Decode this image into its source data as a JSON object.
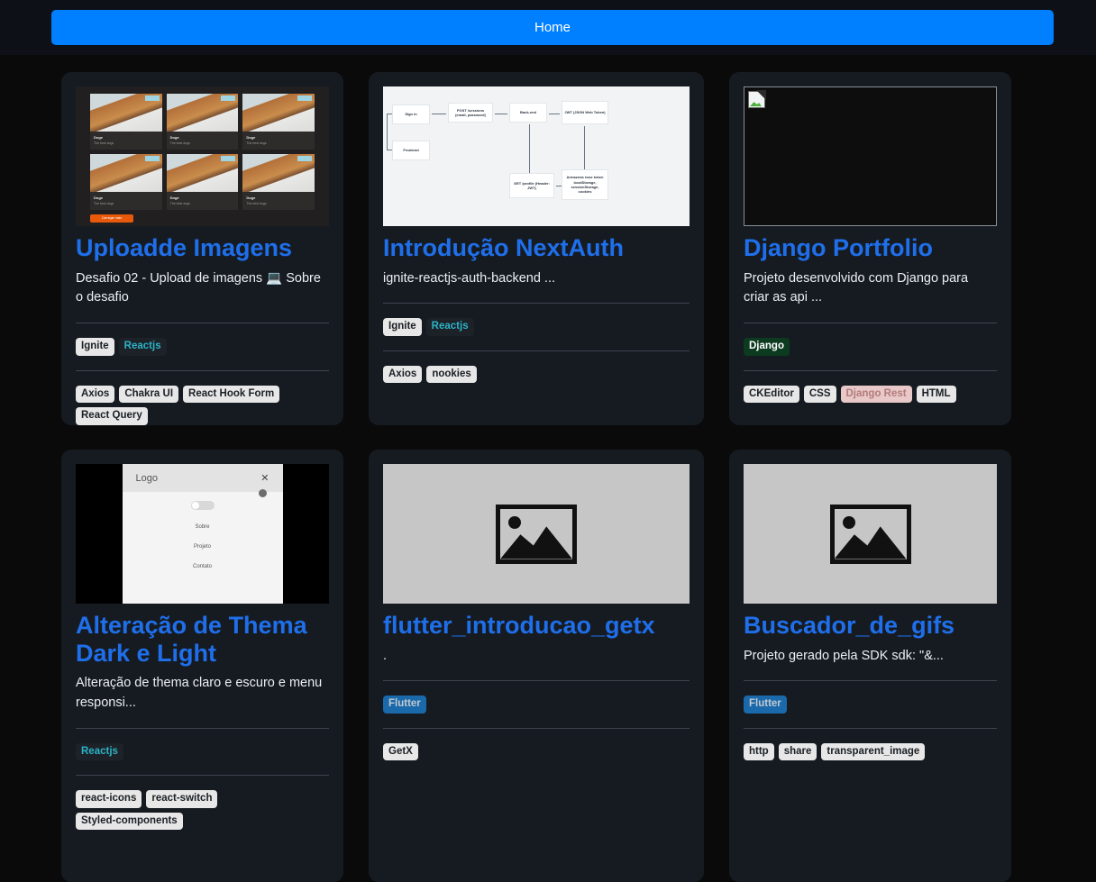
{
  "header": {
    "home_label": "Home",
    "accent_color": "#007fff"
  },
  "theme": {
    "page_bg": "#0a0a0a",
    "card_bg": "#161b22",
    "title_color": "#1f6feb",
    "divider_color": "#3d444d"
  },
  "cards": [
    {
      "title": "Uploadde Imagens",
      "description": "Desafio 02 - Upload de imagens 💻 Sobre o desafio",
      "thumb_kind": "doge-gallery",
      "thumb": {
        "item_title": "Doge",
        "item_subtitles": [
          "The best dogs",
          "The best dogs",
          "The best dogs",
          "The best dogs",
          "The best dogs",
          "The best dogs"
        ],
        "button_label": "Carregar mais"
      },
      "topics": [
        {
          "label": "Ignite",
          "style": "t-ignite"
        },
        {
          "label": "Reactjs",
          "style": "t-reactjs"
        }
      ],
      "libs": [
        "Axios",
        "Chakra UI",
        "React Hook Form",
        "React Query"
      ]
    },
    {
      "title": "Introdução NextAuth",
      "description": "ignite-reactjs-auth-backend ...",
      "thumb_kind": "auth-diagram",
      "thumb": {
        "nodes": [
          "Sign in",
          "Frontend",
          "POST /sessions (email, password)",
          "Back-end",
          "JWT (JSON Web Token)",
          "GET /profile (Header: JWT)",
          "Armazena esse token localStorage, sessionStorage, cookies"
        ]
      },
      "topics": [
        {
          "label": "Ignite",
          "style": "t-ignite"
        },
        {
          "label": "Reactjs",
          "style": "t-reactjs"
        }
      ],
      "libs": [
        "Axios",
        "nookies"
      ]
    },
    {
      "title": "Django Portfolio",
      "description": "Projeto desenvolvido com Django para criar as api ...",
      "thumb_kind": "broken-image",
      "thumb": {},
      "topics": [
        {
          "label": "Django",
          "style": "t-django"
        }
      ],
      "libs": [
        "CKEditor",
        "CSS",
        "Django Rest",
        "HTML"
      ],
      "lib_styles": {
        "Django Rest": "t-djangorest"
      }
    },
    {
      "title": "Alteração de Thema Dark e Light",
      "description": "Alteração de thema claro e escuro e menu responsi...",
      "thumb_kind": "mobile-menu",
      "thumb": {
        "logo": "Logo",
        "close": "✕",
        "items": [
          "Sobre",
          "Projeto",
          "Contato"
        ]
      },
      "topics": [
        {
          "label": "Reactjs",
          "style": "t-reactjs"
        }
      ],
      "libs": [
        "react-icons",
        "react-switch",
        "Styled-components"
      ]
    },
    {
      "title": "flutter_introducao_getx",
      "description": ".",
      "thumb_kind": "placeholder",
      "thumb": {},
      "topics": [
        {
          "label": "Flutter",
          "style": "t-flutter"
        }
      ],
      "libs": [
        "GetX"
      ]
    },
    {
      "title": "Buscador_de_gifs",
      "description": "Projeto gerado pela SDK sdk: \"&...",
      "thumb_kind": "placeholder",
      "thumb": {},
      "topics": [
        {
          "label": "Flutter",
          "style": "t-flutter"
        }
      ],
      "libs": [
        "http",
        "share",
        "transparent_image"
      ]
    }
  ]
}
